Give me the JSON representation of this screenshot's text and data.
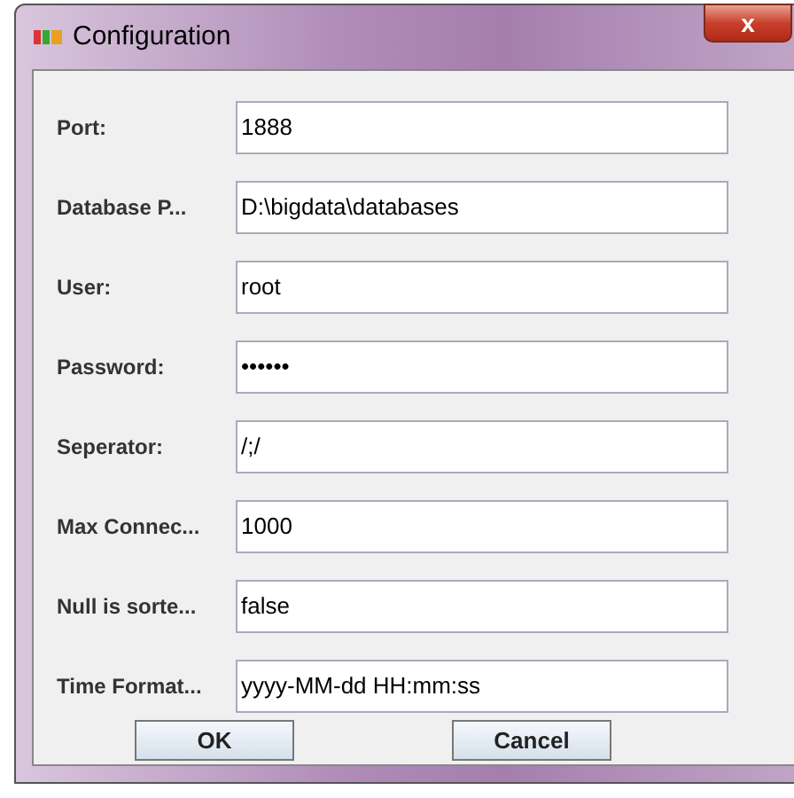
{
  "window": {
    "title": "Configuration",
    "close": "x"
  },
  "fields": [
    {
      "label": "Port:",
      "value": "1888"
    },
    {
      "label": "Database P...",
      "value": "D:\\bigdata\\databases"
    },
    {
      "label": "User:",
      "value": "root"
    },
    {
      "label": "Password:",
      "value": "••••••"
    },
    {
      "label": "Seperator:",
      "value": "/;/"
    },
    {
      "label": "Max Connec...",
      "value": "1000"
    },
    {
      "label": "Null is sorte...",
      "value": "false"
    },
    {
      "label": "Time Format...",
      "value": "yyyy-MM-dd HH:mm:ss"
    }
  ],
  "buttons": [
    "OK",
    "Cancel"
  ]
}
